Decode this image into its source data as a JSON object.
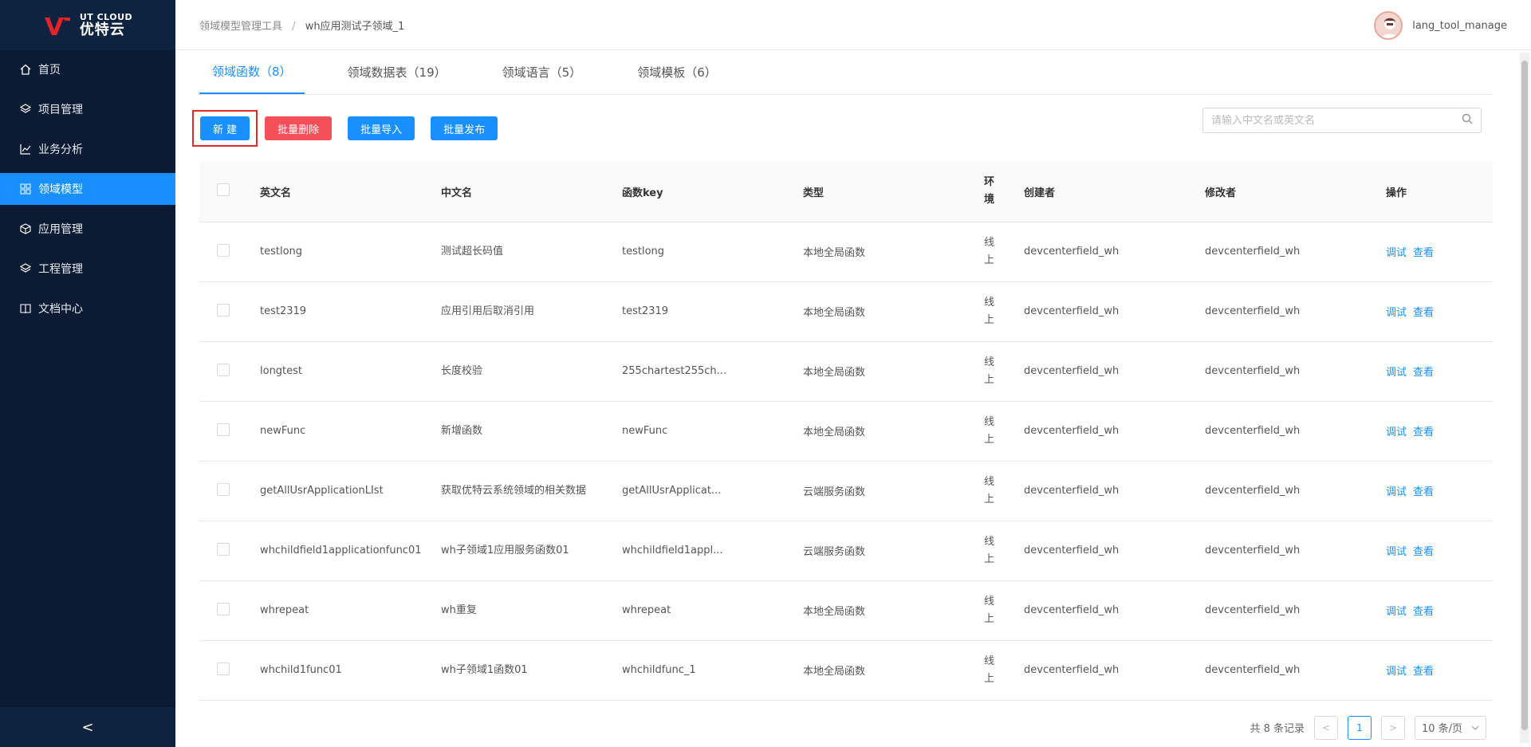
{
  "brand": {
    "name_en": "UT CLOUD",
    "name_cn": "优特云"
  },
  "sidebar": {
    "items": [
      {
        "label": "首页",
        "icon": "home-icon",
        "active": false
      },
      {
        "label": "项目管理",
        "icon": "layers-icon",
        "active": false
      },
      {
        "label": "业务分析",
        "icon": "chart-icon",
        "active": false
      },
      {
        "label": "领域模型",
        "icon": "grid-icon",
        "active": true
      },
      {
        "label": "应用管理",
        "icon": "cube-icon",
        "active": false
      },
      {
        "label": "工程管理",
        "icon": "layers-icon",
        "active": false
      },
      {
        "label": "文档中心",
        "icon": "book-icon",
        "active": false
      }
    ],
    "collapse_glyph": "<"
  },
  "header": {
    "breadcrumb": [
      "领域模型管理工具",
      "wh应用测试子领域_1"
    ],
    "breadcrumb_sep": "/",
    "username": "lang_tool_manage"
  },
  "tabs": [
    {
      "label": "领域函数（8）",
      "active": true
    },
    {
      "label": "领域数据表（19）",
      "active": false
    },
    {
      "label": "领域语言（5）",
      "active": false
    },
    {
      "label": "领域模板（6）",
      "active": false
    }
  ],
  "toolbar": {
    "new_label": "新 建",
    "batch_delete_label": "批量删除",
    "batch_import_label": "批量导入",
    "batch_publish_label": "批量发布",
    "search_placeholder": "请输入中文名或英文名"
  },
  "table": {
    "headers": [
      "英文名",
      "中文名",
      "函数key",
      "类型",
      "环境",
      "创建者",
      "修改者",
      "操作"
    ],
    "action_debug": "调试",
    "action_view": "查看",
    "rows": [
      {
        "en": "testlong",
        "cn": "测试超长码值",
        "key": "testlong",
        "type": "本地全局函数",
        "env": "线上",
        "creator": "devcenterfield_wh",
        "modifier": "devcenterfield_wh"
      },
      {
        "en": "test2319",
        "cn": "应用引用后取消引用",
        "key": "test2319",
        "type": "本地全局函数",
        "env": "线上",
        "creator": "devcenterfield_wh",
        "modifier": "devcenterfield_wh"
      },
      {
        "en": "longtest",
        "cn": "长度校验",
        "key": "255chartest255ch...",
        "type": "本地全局函数",
        "env": "线上",
        "creator": "devcenterfield_wh",
        "modifier": "devcenterfield_wh"
      },
      {
        "en": "newFunc",
        "cn": "新增函数",
        "key": "newFunc",
        "type": "本地全局函数",
        "env": "线上",
        "creator": "devcenterfield_wh",
        "modifier": "devcenterfield_wh"
      },
      {
        "en": "getAllUsrApplicationLIst",
        "cn": "获取优特云系统领域的相关数据",
        "key": "getAllUsrApplicat...",
        "type": "云端服务函数",
        "env": "线上",
        "creator": "devcenterfield_wh",
        "modifier": "devcenterfield_wh"
      },
      {
        "en": "whchildfield1applicationfunc01",
        "cn": "wh子领域1应用服务函数01",
        "key": "whchildfield1appl...",
        "type": "云端服务函数",
        "env": "线上",
        "creator": "devcenterfield_wh",
        "modifier": "devcenterfield_wh"
      },
      {
        "en": "whrepeat",
        "cn": "wh重复",
        "key": "whrepeat",
        "type": "本地全局函数",
        "env": "线上",
        "creator": "devcenterfield_wh",
        "modifier": "devcenterfield_wh"
      },
      {
        "en": "whchild1func01",
        "cn": "wh子领域1函数01",
        "key": "whchildfunc_1",
        "type": "本地全局函数",
        "env": "线上",
        "creator": "devcenterfield_wh",
        "modifier": "devcenterfield_wh"
      }
    ]
  },
  "pagination": {
    "total_text": "共 8 条记录",
    "prev": "<",
    "current_page": "1",
    "next": ">",
    "page_size": "10 条/页"
  },
  "colors": {
    "sidebar_bg": "#0c1b33",
    "accent": "#1890ff",
    "danger": "#f5505a"
  }
}
